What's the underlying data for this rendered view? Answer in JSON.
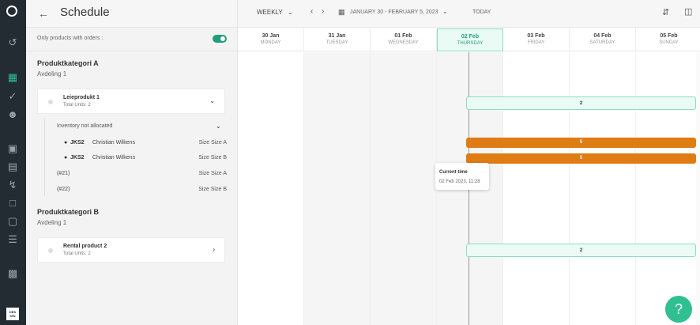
{
  "header": {
    "title": "Schedule",
    "view_mode": "WEEKLY",
    "date_range": "JANUARY 30 - FEBRUARY 5, 2023",
    "today_label": "TODAY"
  },
  "filter": {
    "label": "Only products with orders :",
    "enabled": true
  },
  "categories": [
    {
      "title": "Produktkategori A",
      "subtitle": "Avdeling 1",
      "product": {
        "name": "Leieprodukt 1",
        "units": "Total Units: 2"
      },
      "inventory_header": "Inventory not allocated",
      "rows": [
        {
          "code": "JKS2",
          "person": "Christian Wilkens",
          "size": "Size Size A"
        },
        {
          "code": "JKS2",
          "person": "Christian Wilkens",
          "size": "Size Size B"
        },
        {
          "code": "(#21)",
          "size": "Size Size A"
        },
        {
          "code": "(#22)",
          "size": "Size Size B"
        }
      ]
    },
    {
      "title": "Produktkategori B",
      "subtitle": "Avdeling 1",
      "product": {
        "name": "Rental product 2",
        "units": "Total Units: 2"
      }
    }
  ],
  "days": [
    {
      "date": "30 Jan",
      "weekday": "MONDAY"
    },
    {
      "date": "31 Jan",
      "weekday": "TUESDAY"
    },
    {
      "date": "01 Feb",
      "weekday": "WEDNESDAY"
    },
    {
      "date": "02 Feb",
      "weekday": "THURSDAY"
    },
    {
      "date": "03 Feb",
      "weekday": "FRIDAY"
    },
    {
      "date": "04 Feb",
      "weekday": "SATURDAY"
    },
    {
      "date": "05 Feb",
      "weekday": "SUNDAY"
    }
  ],
  "bars": [
    {
      "label": "2",
      "style": "mint"
    },
    {
      "label": "5",
      "style": "orange"
    },
    {
      "label": "5",
      "style": "orange"
    },
    {
      "label": "2",
      "style": "mint"
    }
  ],
  "tooltip": {
    "title": "Current time",
    "value": "02 Feb 2023, 11:28"
  },
  "help_label": "?",
  "brand_text": "DES IGN",
  "colors": {
    "accent": "#2fbf91",
    "toggle": "#1f9e7a",
    "booking": "#df7c14",
    "rail": "#232b33"
  }
}
